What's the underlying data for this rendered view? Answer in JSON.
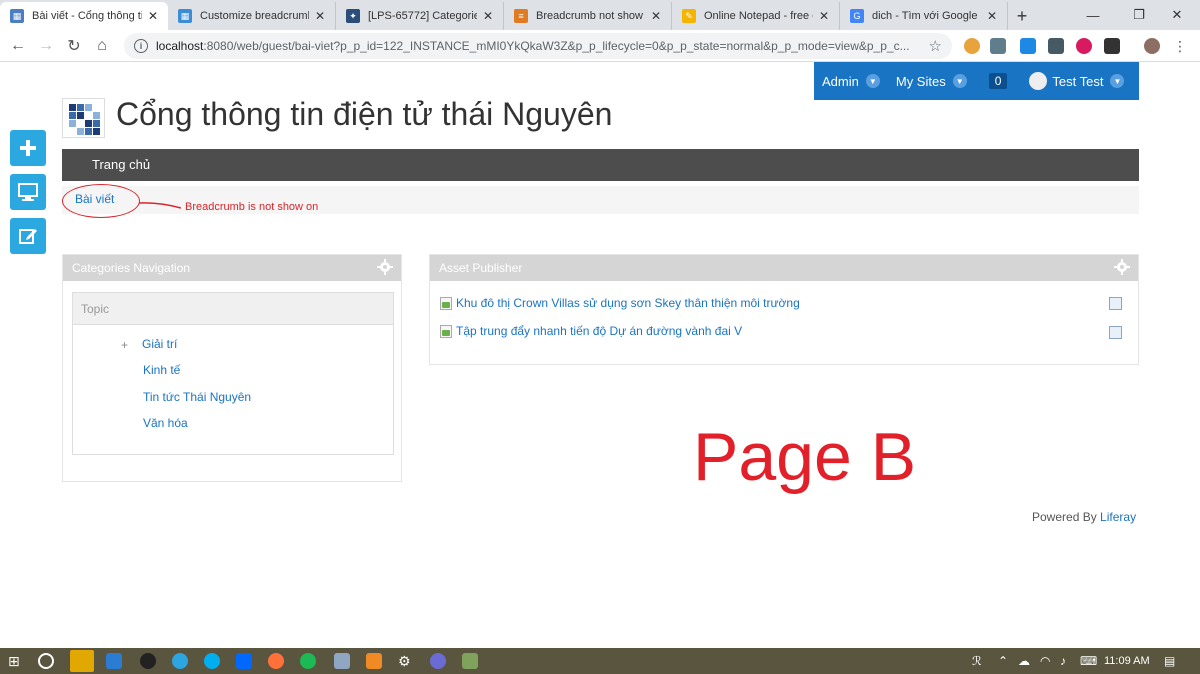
{
  "browser": {
    "tabs": [
      {
        "title": "Bài viết - Cổng thông ti",
        "active": true,
        "color": "#4a7fc1"
      },
      {
        "title": "Customize breadcrumb",
        "active": false,
        "color": "#3b8ed6"
      },
      {
        "title": "[LPS-65772] Categorie",
        "active": false,
        "color": "#2b4d7a"
      },
      {
        "title": "Breadcrumb not show o",
        "active": false,
        "color": "#e07b22"
      },
      {
        "title": "Online Notepad - free o",
        "active": false,
        "color": "#f4b400"
      },
      {
        "title": "dich - Tìm với Google",
        "active": false,
        "color": "#4285f4"
      }
    ],
    "address": {
      "host": "localhost",
      "rest": ":8080/web/guest/bai-viet?p_p_id=122_INSTANCE_mMI0YkQkaW3Z&p_p_lifecycle=0&p_p_state=normal&p_p_mode=view&p_p_c..."
    }
  },
  "adminbar": {
    "admin": "Admin",
    "my_sites": "My Sites",
    "count": "0",
    "user": "Test Test"
  },
  "site": {
    "title": "Cổng thông tin điện tử thái Nguyên",
    "nav_home": "Trang chủ",
    "breadcrumb": "Bài viết"
  },
  "annotation": {
    "text": "Breadcrumb is not show on",
    "page_label": "Page B"
  },
  "categories_nav": {
    "title": "Categories Navigation",
    "topic": "Topic",
    "expand_symbol": "+",
    "items": [
      "Giải trí",
      "Kinh tế",
      "Tin tức Thái Nguyên",
      "Văn hóa"
    ]
  },
  "asset_publisher": {
    "title": "Asset Publisher",
    "items": [
      "Khu đô thị Crown Villas sử dụng sơn Skey thân thiện môi trường",
      "Tập trung đẩy nhanh tiến độ Dự án đường vành đai V"
    ]
  },
  "footer": {
    "powered_by": "Powered By",
    "liferay": "Liferay"
  },
  "taskbar": {
    "time": "11:09 AM"
  },
  "colors": {
    "accent": "#1a74c4",
    "annotation": "#e2202a",
    "dock": "#2ba8e0"
  }
}
